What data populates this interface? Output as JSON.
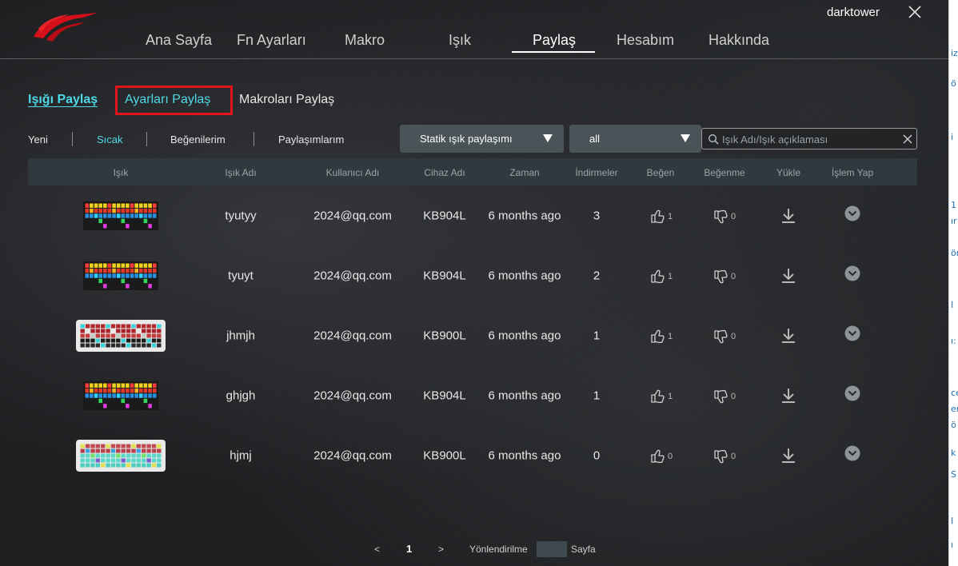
{
  "header": {
    "username": "darktower",
    "nav": [
      {
        "label": "Ana Sayfa",
        "active": false
      },
      {
        "label": "Fn Ayarları",
        "active": false
      },
      {
        "label": "Makro",
        "active": false
      },
      {
        "label": "Işık",
        "active": false
      },
      {
        "label": "Paylaş",
        "active": true
      },
      {
        "label": "Hesabım",
        "active": false
      },
      {
        "label": "Hakkında",
        "active": false
      }
    ]
  },
  "share_tabs": [
    {
      "label": "Işığı Paylaş",
      "active": true
    },
    {
      "label": "Ayarları Paylaş",
      "highlighted": true
    },
    {
      "label": "Makroları Paylaş"
    }
  ],
  "filters": [
    "Yeni",
    "Sıcak",
    "Beğenilerim",
    "Paylaşımlarım"
  ],
  "active_filter": "Sıcak",
  "share_type_select": {
    "value": "Statik ışık paylaşımı"
  },
  "device_select": {
    "value": "all"
  },
  "search": {
    "placeholder": "Işık Adı/Işık açıklaması",
    "value": ""
  },
  "table": {
    "columns": [
      "Işık",
      "Işık Adı",
      "Kullanıcı Adı",
      "Cihaz Adı",
      "Zaman",
      "İndirmeler",
      "Beğen",
      "Beğenme",
      "Yükle",
      "İşlem Yap"
    ],
    "rows": [
      {
        "preview": "keyboard-rgb-yellow",
        "name": "tyutyy",
        "user": "2024@qq.com",
        "device": "KB904L",
        "time": "6 months ago",
        "downloads": "3",
        "likes": "1",
        "dislikes": "0"
      },
      {
        "preview": "keyboard-rgb-yellow",
        "name": "tyuyt",
        "user": "2024@qq.com",
        "device": "KB904L",
        "time": "6 months ago",
        "downloads": "2",
        "likes": "1",
        "dislikes": "0"
      },
      {
        "preview": "keyboard-white-red",
        "name": "jhmjh",
        "user": "2024@qq.com",
        "device": "KB900L",
        "time": "6 months ago",
        "downloads": "1",
        "likes": "1",
        "dislikes": "0"
      },
      {
        "preview": "keyboard-rgb-yellow",
        "name": "ghjgh",
        "user": "2024@qq.com",
        "device": "KB904L",
        "time": "6 months ago",
        "downloads": "1",
        "likes": "1",
        "dislikes": "0"
      },
      {
        "preview": "keyboard-white-teal",
        "name": "hjmj",
        "user": "2024@qq.com",
        "device": "KB900L",
        "time": "6 months ago",
        "downloads": "0",
        "likes": "0",
        "dislikes": "0"
      }
    ]
  },
  "pagination": {
    "prev": "<",
    "current": "1",
    "next": ">",
    "goto_label": "Yönlendirilme",
    "page_label": "Sayfa"
  },
  "colors": {
    "accent": "#4fd8e8",
    "highlight_box": "#e0151b",
    "logo": "#d6101a",
    "table_header": "#2f393e",
    "select_bg": "#4a5358"
  },
  "edge_text": [
    "iz",
    "ö",
    "i",
    "1",
    "ır",
    "ör",
    "I",
    "ı:",
    "ce",
    "er",
    "ö",
    "k",
    "S",
    "I",
    "ı"
  ]
}
